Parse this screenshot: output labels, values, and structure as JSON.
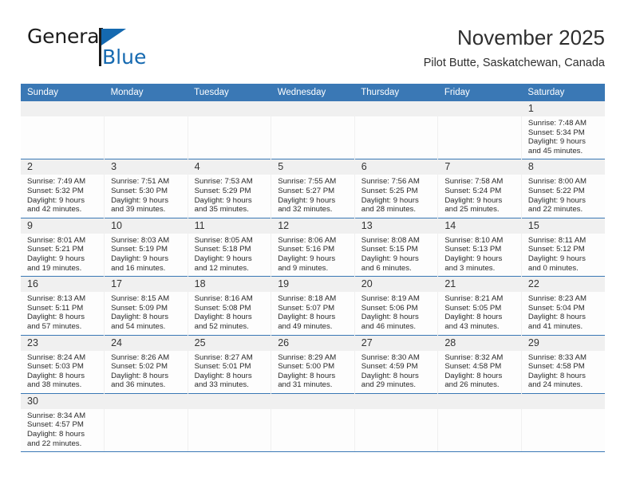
{
  "brand": {
    "name_top": "General",
    "name_bottom": "Blue",
    "flag_icon": "blue-triangle-flag-icon",
    "accent_color": "#1569b0"
  },
  "header": {
    "month_title": "November 2025",
    "location": "Pilot Butte, Saskatchewan, Canada"
  },
  "calendar": {
    "header_color": "#3a78b5",
    "weekday_headers": [
      "Sunday",
      "Monday",
      "Tuesday",
      "Wednesday",
      "Thursday",
      "Friday",
      "Saturday"
    ],
    "weeks": [
      [
        {
          "day": "",
          "empty": true,
          "lines": []
        },
        {
          "day": "",
          "empty": true,
          "lines": []
        },
        {
          "day": "",
          "empty": true,
          "lines": []
        },
        {
          "day": "",
          "empty": true,
          "lines": []
        },
        {
          "day": "",
          "empty": true,
          "lines": []
        },
        {
          "day": "",
          "empty": true,
          "lines": []
        },
        {
          "day": "1",
          "empty": false,
          "lines": [
            "Sunrise: 7:48 AM",
            "Sunset: 5:34 PM",
            "Daylight: 9 hours",
            "and 45 minutes."
          ]
        }
      ],
      [
        {
          "day": "2",
          "empty": false,
          "lines": [
            "Sunrise: 7:49 AM",
            "Sunset: 5:32 PM",
            "Daylight: 9 hours",
            "and 42 minutes."
          ]
        },
        {
          "day": "3",
          "empty": false,
          "lines": [
            "Sunrise: 7:51 AM",
            "Sunset: 5:30 PM",
            "Daylight: 9 hours",
            "and 39 minutes."
          ]
        },
        {
          "day": "4",
          "empty": false,
          "lines": [
            "Sunrise: 7:53 AM",
            "Sunset: 5:29 PM",
            "Daylight: 9 hours",
            "and 35 minutes."
          ]
        },
        {
          "day": "5",
          "empty": false,
          "lines": [
            "Sunrise: 7:55 AM",
            "Sunset: 5:27 PM",
            "Daylight: 9 hours",
            "and 32 minutes."
          ]
        },
        {
          "day": "6",
          "empty": false,
          "lines": [
            "Sunrise: 7:56 AM",
            "Sunset: 5:25 PM",
            "Daylight: 9 hours",
            "and 28 minutes."
          ]
        },
        {
          "day": "7",
          "empty": false,
          "lines": [
            "Sunrise: 7:58 AM",
            "Sunset: 5:24 PM",
            "Daylight: 9 hours",
            "and 25 minutes."
          ]
        },
        {
          "day": "8",
          "empty": false,
          "lines": [
            "Sunrise: 8:00 AM",
            "Sunset: 5:22 PM",
            "Daylight: 9 hours",
            "and 22 minutes."
          ]
        }
      ],
      [
        {
          "day": "9",
          "empty": false,
          "lines": [
            "Sunrise: 8:01 AM",
            "Sunset: 5:21 PM",
            "Daylight: 9 hours",
            "and 19 minutes."
          ]
        },
        {
          "day": "10",
          "empty": false,
          "lines": [
            "Sunrise: 8:03 AM",
            "Sunset: 5:19 PM",
            "Daylight: 9 hours",
            "and 16 minutes."
          ]
        },
        {
          "day": "11",
          "empty": false,
          "lines": [
            "Sunrise: 8:05 AM",
            "Sunset: 5:18 PM",
            "Daylight: 9 hours",
            "and 12 minutes."
          ]
        },
        {
          "day": "12",
          "empty": false,
          "lines": [
            "Sunrise: 8:06 AM",
            "Sunset: 5:16 PM",
            "Daylight: 9 hours",
            "and 9 minutes."
          ]
        },
        {
          "day": "13",
          "empty": false,
          "lines": [
            "Sunrise: 8:08 AM",
            "Sunset: 5:15 PM",
            "Daylight: 9 hours",
            "and 6 minutes."
          ]
        },
        {
          "day": "14",
          "empty": false,
          "lines": [
            "Sunrise: 8:10 AM",
            "Sunset: 5:13 PM",
            "Daylight: 9 hours",
            "and 3 minutes."
          ]
        },
        {
          "day": "15",
          "empty": false,
          "lines": [
            "Sunrise: 8:11 AM",
            "Sunset: 5:12 PM",
            "Daylight: 9 hours",
            "and 0 minutes."
          ]
        }
      ],
      [
        {
          "day": "16",
          "empty": false,
          "lines": [
            "Sunrise: 8:13 AM",
            "Sunset: 5:11 PM",
            "Daylight: 8 hours",
            "and 57 minutes."
          ]
        },
        {
          "day": "17",
          "empty": false,
          "lines": [
            "Sunrise: 8:15 AM",
            "Sunset: 5:09 PM",
            "Daylight: 8 hours",
            "and 54 minutes."
          ]
        },
        {
          "day": "18",
          "empty": false,
          "lines": [
            "Sunrise: 8:16 AM",
            "Sunset: 5:08 PM",
            "Daylight: 8 hours",
            "and 52 minutes."
          ]
        },
        {
          "day": "19",
          "empty": false,
          "lines": [
            "Sunrise: 8:18 AM",
            "Sunset: 5:07 PM",
            "Daylight: 8 hours",
            "and 49 minutes."
          ]
        },
        {
          "day": "20",
          "empty": false,
          "lines": [
            "Sunrise: 8:19 AM",
            "Sunset: 5:06 PM",
            "Daylight: 8 hours",
            "and 46 minutes."
          ]
        },
        {
          "day": "21",
          "empty": false,
          "lines": [
            "Sunrise: 8:21 AM",
            "Sunset: 5:05 PM",
            "Daylight: 8 hours",
            "and 43 minutes."
          ]
        },
        {
          "day": "22",
          "empty": false,
          "lines": [
            "Sunrise: 8:23 AM",
            "Sunset: 5:04 PM",
            "Daylight: 8 hours",
            "and 41 minutes."
          ]
        }
      ],
      [
        {
          "day": "23",
          "empty": false,
          "lines": [
            "Sunrise: 8:24 AM",
            "Sunset: 5:03 PM",
            "Daylight: 8 hours",
            "and 38 minutes."
          ]
        },
        {
          "day": "24",
          "empty": false,
          "lines": [
            "Sunrise: 8:26 AM",
            "Sunset: 5:02 PM",
            "Daylight: 8 hours",
            "and 36 minutes."
          ]
        },
        {
          "day": "25",
          "empty": false,
          "lines": [
            "Sunrise: 8:27 AM",
            "Sunset: 5:01 PM",
            "Daylight: 8 hours",
            "and 33 minutes."
          ]
        },
        {
          "day": "26",
          "empty": false,
          "lines": [
            "Sunrise: 8:29 AM",
            "Sunset: 5:00 PM",
            "Daylight: 8 hours",
            "and 31 minutes."
          ]
        },
        {
          "day": "27",
          "empty": false,
          "lines": [
            "Sunrise: 8:30 AM",
            "Sunset: 4:59 PM",
            "Daylight: 8 hours",
            "and 29 minutes."
          ]
        },
        {
          "day": "28",
          "empty": false,
          "lines": [
            "Sunrise: 8:32 AM",
            "Sunset: 4:58 PM",
            "Daylight: 8 hours",
            "and 26 minutes."
          ]
        },
        {
          "day": "29",
          "empty": false,
          "lines": [
            "Sunrise: 8:33 AM",
            "Sunset: 4:58 PM",
            "Daylight: 8 hours",
            "and 24 minutes."
          ]
        }
      ],
      [
        {
          "day": "30",
          "empty": false,
          "lines": [
            "Sunrise: 8:34 AM",
            "Sunset: 4:57 PM",
            "Daylight: 8 hours",
            "and 22 minutes."
          ]
        },
        {
          "day": "",
          "empty": true,
          "lines": []
        },
        {
          "day": "",
          "empty": true,
          "lines": []
        },
        {
          "day": "",
          "empty": true,
          "lines": []
        },
        {
          "day": "",
          "empty": true,
          "lines": []
        },
        {
          "day": "",
          "empty": true,
          "lines": []
        },
        {
          "day": "",
          "empty": true,
          "lines": []
        }
      ]
    ]
  }
}
